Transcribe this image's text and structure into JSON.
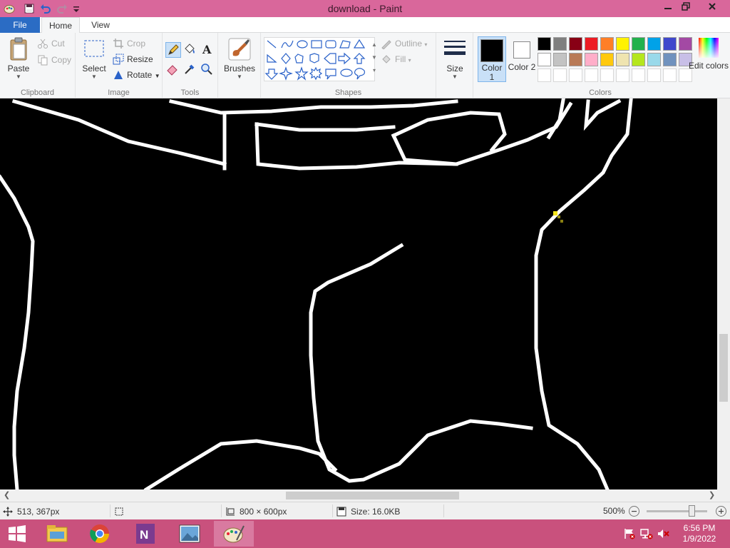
{
  "window": {
    "title": "download - Paint",
    "minimize_icon": "minimize-icon",
    "restore_icon": "restore-icon",
    "close_icon": "close-icon"
  },
  "quick_access": {
    "icons": [
      "paint-app-icon",
      "save-icon",
      "undo-icon",
      "redo-icon",
      "customize-dropdown-icon"
    ]
  },
  "tabs": {
    "file": "File",
    "home": "Home",
    "view": "View"
  },
  "clipboard": {
    "paste": "Paste",
    "cut": "Cut",
    "copy": "Copy",
    "label": "Clipboard"
  },
  "image": {
    "select": "Select",
    "crop": "Crop",
    "resize": "Resize",
    "rotate": "Rotate",
    "label": "Image"
  },
  "tools": {
    "label": "Tools",
    "items": [
      "pencil-icon",
      "fill-bucket-icon",
      "text-icon",
      "eraser-icon",
      "color-picker-icon",
      "magnifier-icon"
    ]
  },
  "brushes": {
    "label": "Brushes"
  },
  "shapes": {
    "outline": "Outline",
    "fill": "Fill",
    "label": "Shapes"
  },
  "size": {
    "label": "Size"
  },
  "colors": {
    "color1_label": "Color 1",
    "color1_value": "#000000",
    "color2_label": "Color 2",
    "color2_value": "#ffffff",
    "edit_colors": "Edit colors",
    "label": "Colors",
    "palette_row1": [
      "#000000",
      "#7f7f7f",
      "#880015",
      "#ed1c24",
      "#ff7f27",
      "#fff200",
      "#22b14c",
      "#00a2e8",
      "#3f48cc",
      "#a349a4"
    ],
    "palette_row2": [
      "#ffffff",
      "#c3c3c3",
      "#b97a57",
      "#ffaec9",
      "#ffc90e",
      "#efe4b0",
      "#b5e61d",
      "#99d9ea",
      "#7092be",
      "#c8bfe7"
    ]
  },
  "status": {
    "cursor_position": "513, 367px",
    "canvas_size": "800 × 600px",
    "file_size": "Size: 16.0KB",
    "zoom": "500%"
  },
  "taskbar": {
    "apps": [
      "start-icon",
      "file-explorer-icon",
      "chrome-icon",
      "onenote-icon",
      "photos-icon",
      "paint-icon"
    ],
    "time": "6:56 PM",
    "date": "1/9/2022"
  }
}
